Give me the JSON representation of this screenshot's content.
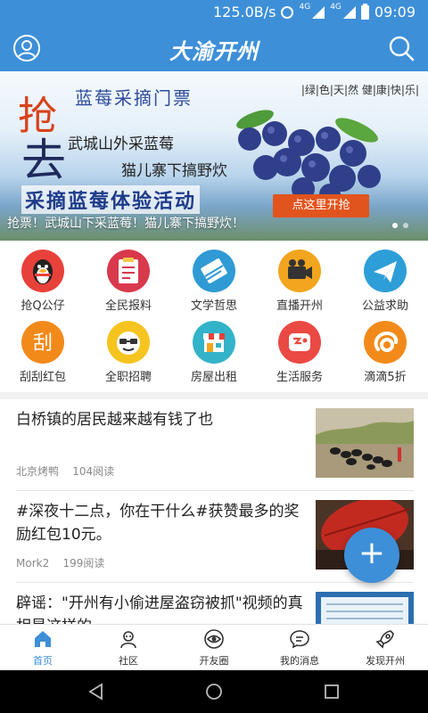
{
  "status_bar": {
    "speed": "125.0B/s",
    "net1": "4G",
    "net2": "4G",
    "time": "09:09"
  },
  "header": {
    "logo": "大渝开州"
  },
  "banner": {
    "grab": "抢",
    "go": "去",
    "title": "蓝莓采摘门票",
    "tags": "|绿|色|天|然  健|康|快|乐|",
    "line1": "武城山外采蓝莓",
    "line2": "猫儿寨下搞野炊",
    "slogan": "采摘蓝莓体验活动",
    "cta": "点这里开抢",
    "caption": "抢票！武城山下采蓝莓！猫儿寨下搞野炊！"
  },
  "grid": [
    {
      "label": "抢Q公仔",
      "icon": "qq-penguin-icon",
      "color": "#e8413a"
    },
    {
      "label": "全民报料",
      "icon": "clipboard-icon",
      "color": "#d9394c"
    },
    {
      "label": "文学哲思",
      "icon": "book-icon",
      "color": "#2f9ad4"
    },
    {
      "label": "直播开州",
      "icon": "video-camera-icon",
      "color": "#f2a51e"
    },
    {
      "label": "公益求助",
      "icon": "paper-plane-icon",
      "color": "#2e9ed8"
    },
    {
      "label": "刮刮红包",
      "icon": "scratch-card-icon",
      "color": "#f28a1a"
    },
    {
      "label": "全职招聘",
      "icon": "face-glasses-icon",
      "color": "#f5c41f"
    },
    {
      "label": "房屋出租",
      "icon": "shop-icon",
      "color": "#33b3c9"
    },
    {
      "label": "生活服务",
      "icon": "service-icon",
      "color": "#ea4a43"
    },
    {
      "label": "滴滴5折",
      "icon": "didi-icon",
      "color": "#f28a1a"
    }
  ],
  "feed": [
    {
      "title": "白桥镇的居民越来越有钱了也",
      "author": "北京烤鸭",
      "reads": "104阅读"
    },
    {
      "title": "#深夜十二点，你在干什么#获赞最多的奖励红包10元。",
      "author": "Mork2",
      "reads": "199阅读"
    },
    {
      "title": "辟谣：\"开州有小偷进屋盗窃被抓\"视频的真相是这样的"
    }
  ],
  "fab": "+",
  "tabs": [
    {
      "label": "首页",
      "icon": "home-icon"
    },
    {
      "label": "社区",
      "icon": "community-icon"
    },
    {
      "label": "开友圈",
      "icon": "circle-eye-icon"
    },
    {
      "label": "我的消息",
      "icon": "message-icon"
    },
    {
      "label": "发现开州",
      "icon": "rocket-icon"
    }
  ],
  "colors": {
    "brand": "#3d8fd8",
    "cta": "#e2541d"
  }
}
